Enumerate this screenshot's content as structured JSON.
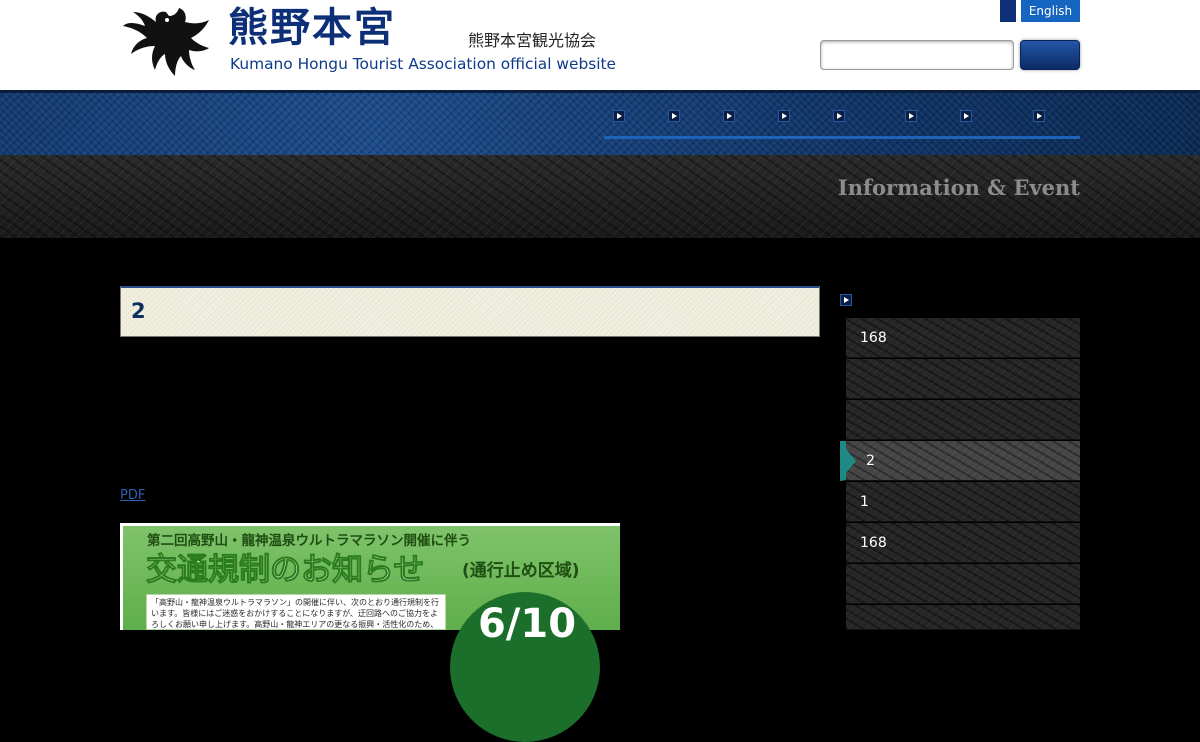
{
  "header": {
    "logo_title": "熊野本宮",
    "logo_subtitle_jp": "熊野本宮観光協会",
    "logo_subtitle_en": "Kumano Hongu Tourist Association official website",
    "lang_english": "English",
    "search_placeholder": "",
    "search_button_label": ""
  },
  "nav": {
    "items": [
      "",
      "",
      "",
      "",
      "",
      "",
      "",
      ""
    ]
  },
  "title_band": {
    "title": "",
    "title_en": "Information & Event"
  },
  "main": {
    "post_heading": "2",
    "pdf_link": "PDF",
    "poster": {
      "line1": "第二回高野山・龍神温泉ウルトラマラソン開催に伴う",
      "line2": "交通規制のお知らせ",
      "line2_sub": "(通行止め区域)",
      "notice": "「高野山・龍神温泉ウルトラマラソン」の開催に伴い、次のとおり通行規制を行います。皆様にはご迷惑をおかけすることになりますが、迂回路へのご協力をよろしくお願い申し上げます。高野山・龍神エリアの更なる振興・活性化のため、本大会へのご理解",
      "date": "6/10"
    }
  },
  "sidebar": {
    "items": [
      {
        "label": "168",
        "active": false
      },
      {
        "label": "",
        "active": false
      },
      {
        "label": "",
        "active": false
      },
      {
        "label": "2",
        "active": true
      },
      {
        "label": "1",
        "active": false
      },
      {
        "label": "168",
        "active": false
      },
      {
        "label": "",
        "active": false
      },
      {
        "label": "",
        "active": false
      }
    ]
  },
  "colors": {
    "brand_navy": "#0d2f78",
    "accent_blue": "#1565c0",
    "active_teal": "#1d8a86",
    "poster_green": "#5fae4c"
  },
  "icons": {
    "logo_mark": "crow-emblem-icon",
    "nav_bullet": "play-triangle-icon",
    "sidebar_bullet": "play-triangle-icon",
    "active_marker": "triangle-right-icon"
  }
}
